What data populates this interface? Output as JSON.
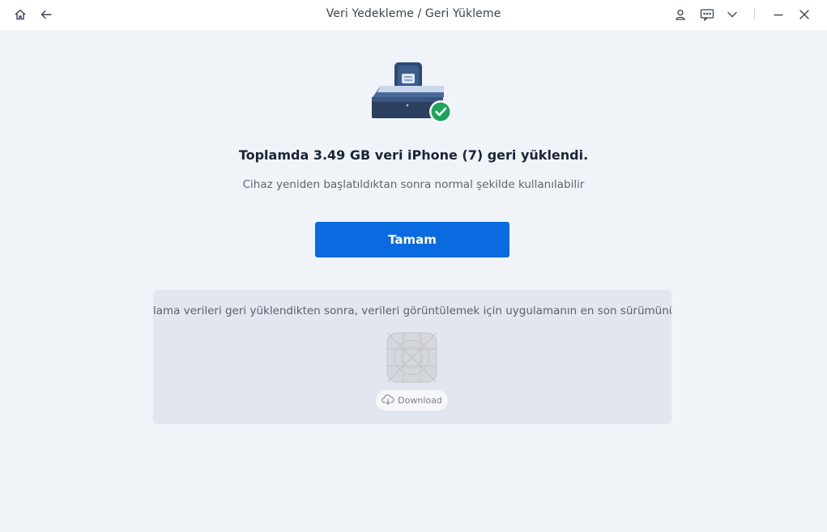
{
  "window": {
    "title": "Veri Yedekleme / Geri Yükleme",
    "icons": [
      "home-icon",
      "back-arrow-icon",
      "account-icon",
      "feedback-icon",
      "chevron-down-icon",
      "minimize-icon",
      "close-icon"
    ]
  },
  "result": {
    "title": "Toplamda 3.49 GB veri iPhone (7) geri yüklendi.",
    "subtitle": "Cihaz yeniden başlatıldıktan sonra normal şekilde kullanılabilir",
    "ok_label": "Tamam",
    "success_badge_color": "#1ea35a"
  },
  "info": {
    "text": "lama verileri geri yüklendikten sonra, verileri görüntülemek için uygulamanın en son sürümünü",
    "download_label": "Download"
  },
  "colors": {
    "accent": "#0a6ae0",
    "background": "#f0f4f9",
    "panel": "#e2e6ee"
  }
}
